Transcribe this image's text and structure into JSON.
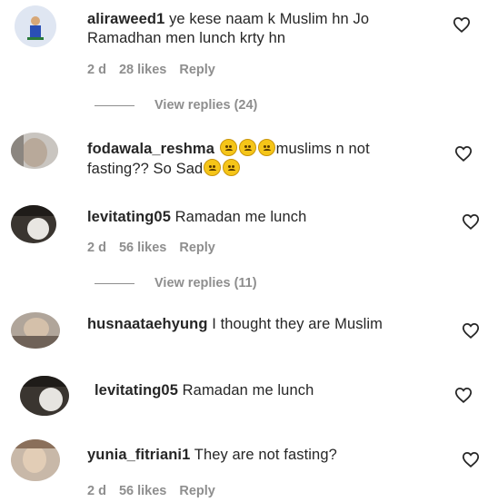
{
  "comments": [
    {
      "username": "aliraweed1",
      "text": " ye kese naam k Muslim hn Jo Ramadhan men lunch krty hn",
      "time": "2 d",
      "likes": "28 likes",
      "reply": "Reply",
      "view_replies": "View replies (24)"
    },
    {
      "username": "fodawala_reshma",
      "text_before": " ",
      "text_mid": "muslims n not fasting?? So Sad",
      "emoji": "sad-face-emoji"
    },
    {
      "username": "levitating05",
      "text": " Ramadan me lunch",
      "time": "2 d",
      "likes": "56 likes",
      "reply": "Reply",
      "view_replies": "View replies (11)"
    },
    {
      "username": "husnaataehyung",
      "text": " I thought they are Muslim"
    },
    {
      "username": "levitating05",
      "text": " Ramadan me lunch"
    },
    {
      "username": "yunia_fitriani1",
      "text": " They are not fasting?",
      "time": "2 d",
      "likes": "56 likes",
      "reply": "Reply"
    }
  ],
  "icons": {
    "like": "heart-outline-icon"
  },
  "colors": {
    "text": "#262626",
    "secondary": "#8e8e8e"
  }
}
